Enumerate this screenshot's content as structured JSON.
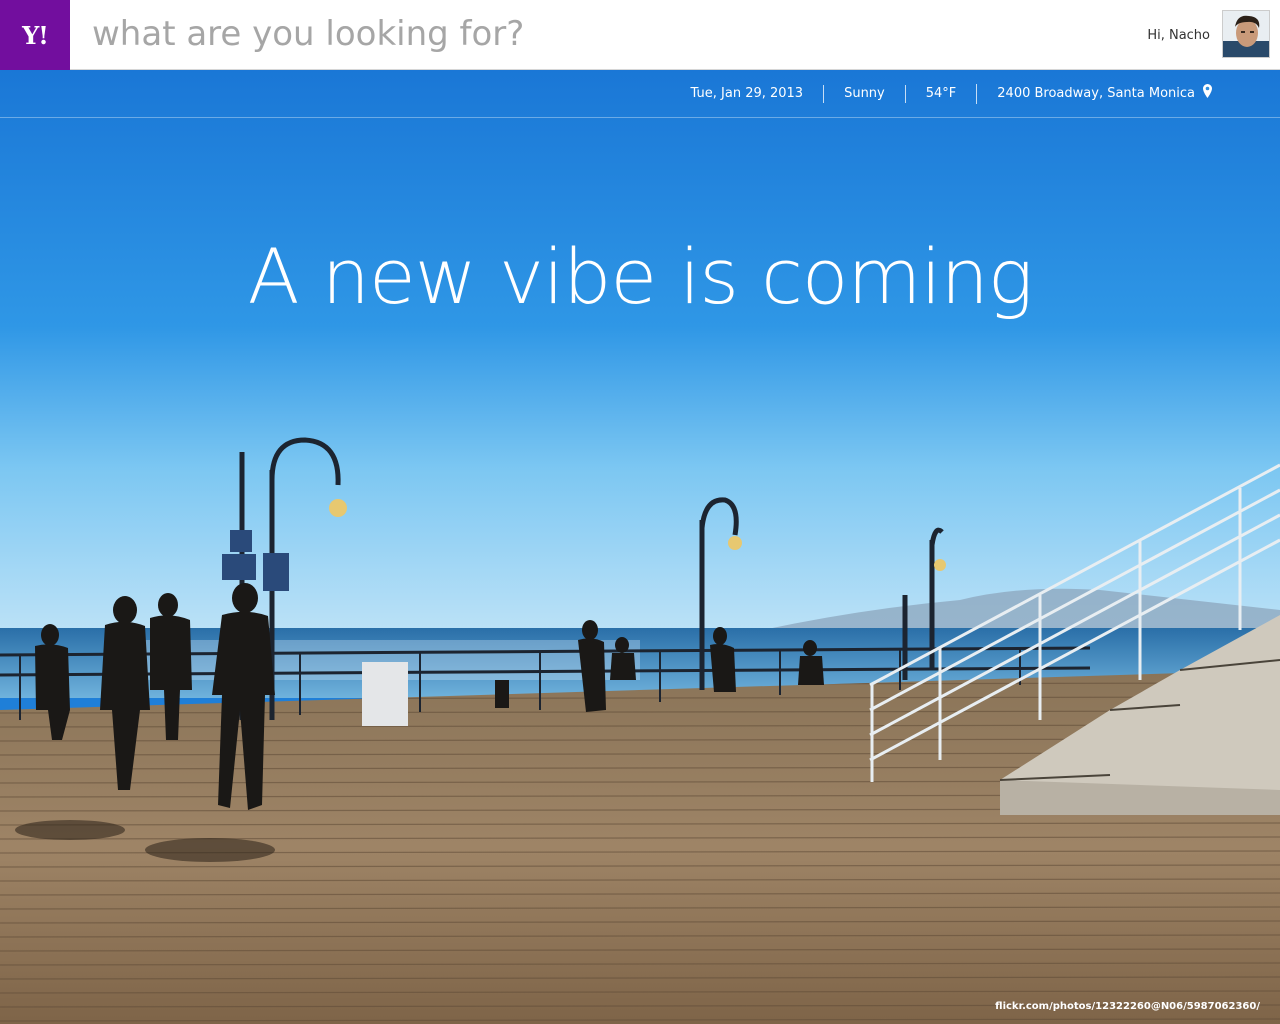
{
  "header": {
    "logo_text": "Y!",
    "search_placeholder": "what are you looking for?",
    "greeting": "Hi, Nacho",
    "brand_color": "#720e9e"
  },
  "infobar": {
    "date": "Tue, Jan 29, 2013",
    "weather": "Sunny",
    "temperature": "54°F",
    "location": "2400 Broadway, Santa Monica",
    "location_icon": "map-pin-icon"
  },
  "hero": {
    "headline": "A new vibe is coming",
    "photo_credit": "flickr.com/photos/12322260@N06/5987062360/"
  }
}
